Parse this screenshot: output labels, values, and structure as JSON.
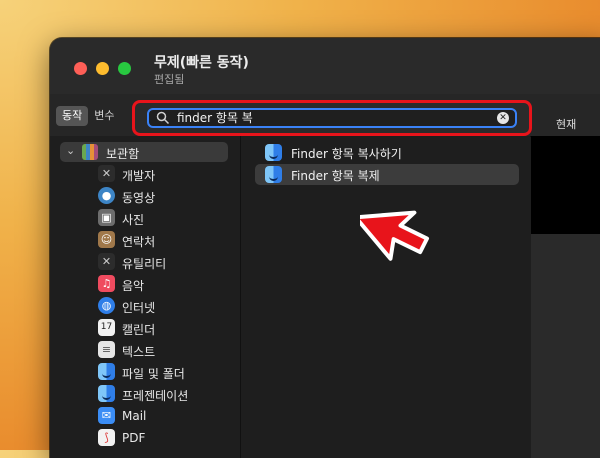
{
  "window": {
    "title": "무제(빠른 동작)",
    "subtitle": "편집됨"
  },
  "toolbar": {
    "tabs": [
      {
        "label": "동작",
        "active": true
      },
      {
        "label": "변수",
        "active": false
      }
    ],
    "search": {
      "value": "finder 항목 복",
      "clear_icon": "xmark-circle-icon"
    },
    "right_label": "현재"
  },
  "sidebar": {
    "library": {
      "label": "보관함",
      "icon": "library-icon",
      "expanded": true
    },
    "categories": [
      {
        "label": "개발자",
        "icon": "tools-icon",
        "color": "#2c2c2c"
      },
      {
        "label": "동영상",
        "icon": "video-icon",
        "color": "#3d85c6"
      },
      {
        "label": "사진",
        "icon": "photo-icon",
        "color": "#6d6d6d"
      },
      {
        "label": "연락처",
        "icon": "contacts-icon",
        "color": "#a0784a"
      },
      {
        "label": "유틸리티",
        "icon": "tools-icon",
        "color": "#2c2c2c"
      },
      {
        "label": "음악",
        "icon": "music-icon",
        "color": "#ef4b5f"
      },
      {
        "label": "인터넷",
        "icon": "globe-icon",
        "color": "#2f7ee8"
      },
      {
        "label": "캘린더",
        "icon": "calendar-icon",
        "color": "#f2f2f2"
      },
      {
        "label": "텍스트",
        "icon": "text-icon",
        "color": "#e6e6e6"
      },
      {
        "label": "파일 및 폴더",
        "icon": "finder-icon",
        "color": "#2f7ee8"
      },
      {
        "label": "프레젠테이션",
        "icon": "presentation-icon",
        "color": "#2f7ee8"
      },
      {
        "label": "Mail",
        "icon": "mail-icon",
        "color": "#3b8df5"
      },
      {
        "label": "PDF",
        "icon": "pdf-icon",
        "color": "#f2f2f2"
      }
    ]
  },
  "actions": [
    {
      "label": "Finder 항목 복사하기",
      "icon": "finder-icon",
      "selected": false
    },
    {
      "label": "Finder 항목 복제",
      "icon": "finder-icon",
      "selected": true
    }
  ],
  "annotation": {
    "highlight_color": "#e8141b",
    "arrow_icon": "red-arrow-icon"
  }
}
